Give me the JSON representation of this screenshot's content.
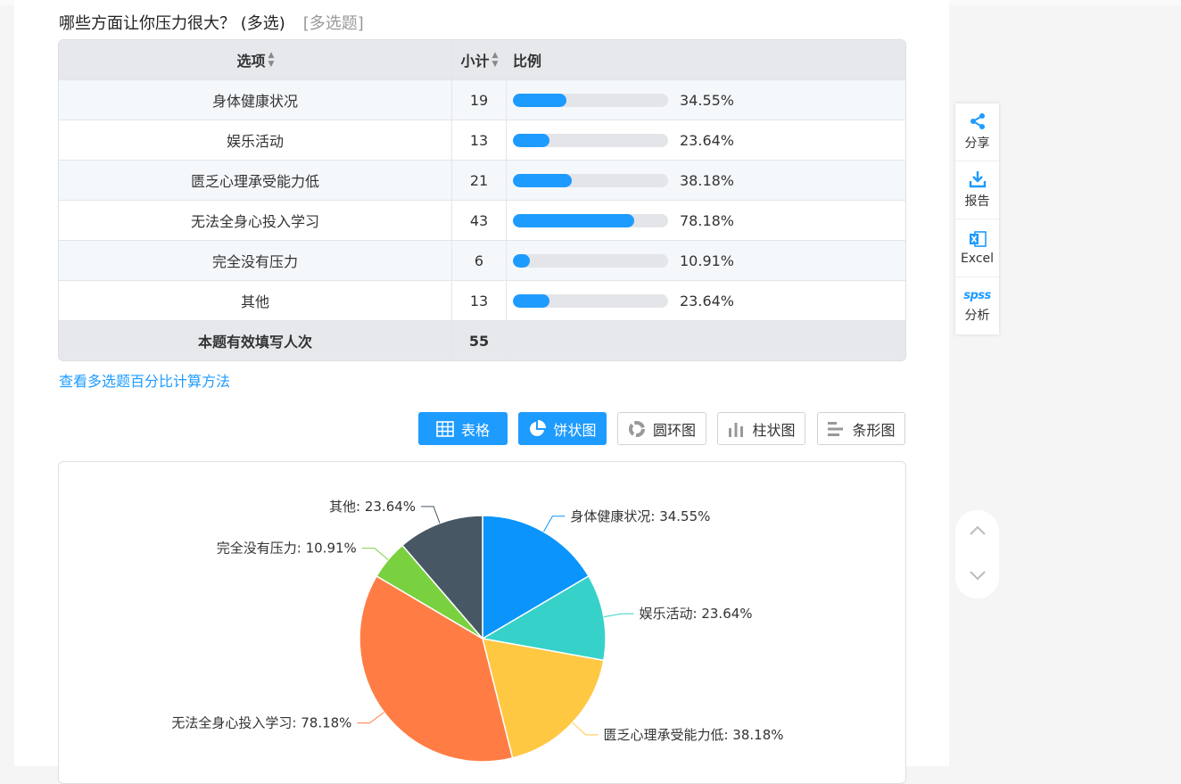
{
  "question": {
    "title": "哪些方面让你压力很大？  (多选)",
    "tag": "[多选题]"
  },
  "table": {
    "headers": {
      "option": "选项",
      "count": "小计",
      "ratio": "比例"
    },
    "rows": [
      {
        "option": "身体健康状况",
        "count": "19",
        "percent": "34.55%",
        "ratio": 0.3455
      },
      {
        "option": "娱乐活动",
        "count": "13",
        "percent": "23.64%",
        "ratio": 0.2364
      },
      {
        "option": "匮乏心理承受能力低",
        "count": "21",
        "percent": "38.18%",
        "ratio": 0.3818
      },
      {
        "option": "无法全身心投入学习",
        "count": "43",
        "percent": "78.18%",
        "ratio": 0.7818
      },
      {
        "option": "完全没有压力",
        "count": "6",
        "percent": "10.91%",
        "ratio": 0.1091
      },
      {
        "option": "其他",
        "count": "13",
        "percent": "23.64%",
        "ratio": 0.2364
      }
    ],
    "total": {
      "label": "本题有效填写人次",
      "count": "55"
    }
  },
  "calc_link": "查看多选题百分比计算方法",
  "chart_buttons": [
    {
      "label": "表格",
      "icon": "table-icon",
      "active": true
    },
    {
      "label": "饼状图",
      "icon": "pie-icon",
      "active": true
    },
    {
      "label": "圆环图",
      "icon": "ring-icon",
      "active": false
    },
    {
      "label": "柱状图",
      "icon": "column-icon",
      "active": false
    },
    {
      "label": "条形图",
      "icon": "bar-icon",
      "active": false
    }
  ],
  "chart_data": {
    "type": "pie",
    "categories": [
      "身体健康状况",
      "娱乐活动",
      "匮乏心理承受能力低",
      "无法全身心投入学习",
      "完全没有压力",
      "其他"
    ],
    "values": [
      19,
      13,
      21,
      43,
      6,
      13
    ],
    "labels": [
      "身体健康状况: 34.55%",
      "娱乐活动: 23.64%",
      "匮乏心理承受能力低: 38.18%",
      "无法全身心投入学习: 78.18%",
      "完全没有压力: 10.91%",
      "其他: 23.64%"
    ],
    "colors": [
      "#0a94fc",
      "#36d1c9",
      "#ffc843",
      "#ff7d45",
      "#7ad13f",
      "#475763"
    ]
  },
  "side_bar": [
    {
      "label": "分享",
      "icon": "share-icon"
    },
    {
      "label": "报告",
      "icon": "download-icon"
    },
    {
      "label": "Excel",
      "icon": "excel-icon"
    },
    {
      "label": "分析",
      "icon": "spss-icon",
      "icon_text": "spss"
    }
  ],
  "nav": {
    "up": "chevron-up-icon",
    "down": "chevron-down-icon"
  },
  "colors": {
    "accent": "#1e9bff"
  }
}
